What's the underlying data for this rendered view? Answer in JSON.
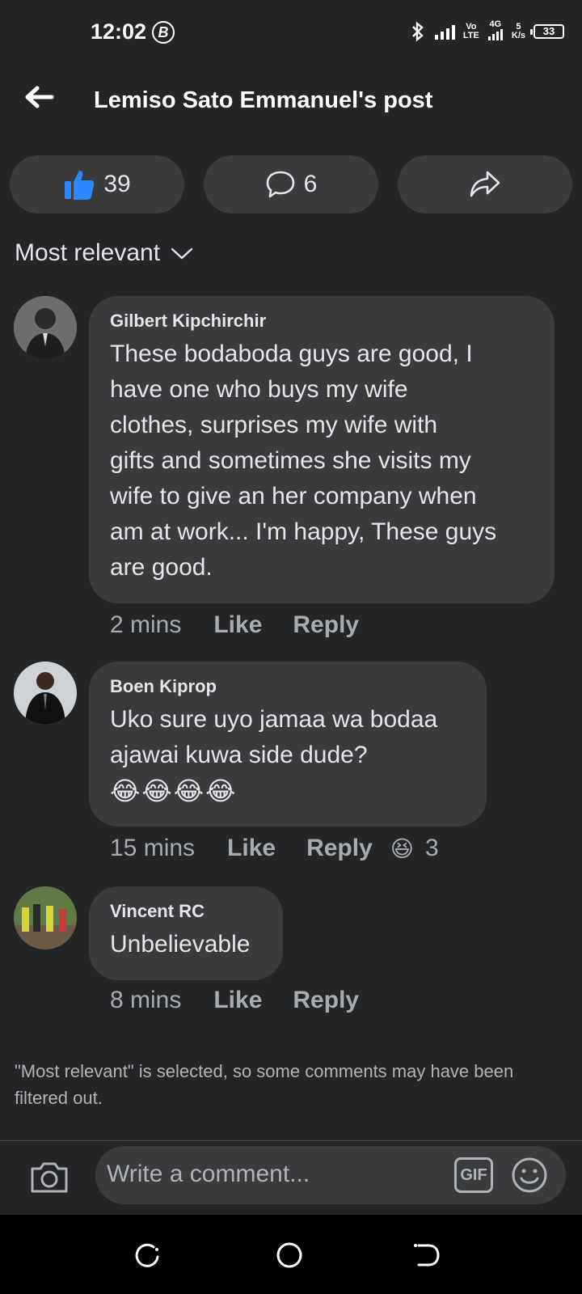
{
  "status_bar": {
    "time": "12:02",
    "b_badge": "B",
    "network_top": "Vo",
    "network_4g": "4G",
    "network_lte": "LTE",
    "speed_value": "5",
    "speed_unit": "K/s",
    "battery": "33"
  },
  "header": {
    "title": "Lemiso Sato Emmanuel's post"
  },
  "actions": {
    "likes": "39",
    "comments": "6"
  },
  "sort": {
    "label": "Most relevant"
  },
  "comments": [
    {
      "name": "Gilbert Kipchirchir",
      "text_lines": [
        "These bodaboda guys are good, I",
        "have one who buys my wife",
        "clothes, surprises my wife with",
        "gifts and sometimes she visits my",
        "wife to give an her company when",
        "am at work... I'm happy, These guys",
        "are good."
      ],
      "time": "2 mins",
      "like": "Like",
      "reply": "Reply"
    },
    {
      "name": "Boen Kiprop",
      "text_lines": [
        "Uko sure uyo jamaa wa bodaa",
        "ajawai kuwa side dude?"
      ],
      "emojis": "😂😂😂😂",
      "time": "15 mins",
      "like": "Like",
      "reply": "Reply",
      "reaction_emoji": "😆",
      "reaction_count": "3"
    },
    {
      "name": "Vincent RC",
      "text_lines": [
        "Unbelievable"
      ],
      "time": "8 mins",
      "like": "Like",
      "reply": "Reply"
    }
  ],
  "filter_note": "\"Most relevant\" is selected, so some comments may have been filtered out.",
  "composer": {
    "placeholder": "Write a comment...",
    "gif_label": "GIF"
  },
  "colors": {
    "background": "#242526",
    "bubble": "#3a3b3c",
    "like_blue": "#2d88ff",
    "text": "#e4e6eb",
    "muted": "#a8abaf"
  }
}
